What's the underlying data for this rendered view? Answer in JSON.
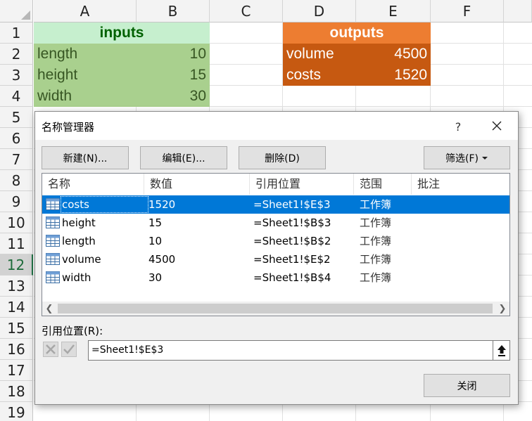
{
  "sheet": {
    "columns": [
      "A",
      "B",
      "C",
      "D",
      "E",
      "F"
    ],
    "rows": [
      "1",
      "2",
      "3",
      "4",
      "5",
      "6",
      "7",
      "8",
      "9",
      "10",
      "11",
      "12",
      "13",
      "14",
      "15",
      "16",
      "17",
      "18",
      "19"
    ],
    "selected_row": "12",
    "inputs_header": "inputs",
    "outputs_header": "outputs",
    "inputs": [
      {
        "label": "length",
        "value": "10"
      },
      {
        "label": "height",
        "value": "15"
      },
      {
        "label": "width",
        "value": "30"
      }
    ],
    "outputs": [
      {
        "label": "volume",
        "value": "4500"
      },
      {
        "label": "costs",
        "value": "1520"
      }
    ],
    "colors": {
      "inputs_header_bg": "#c6efce",
      "inputs_body_bg": "#a9d08e",
      "outputs_header_bg": "#ed7d31",
      "outputs_body_bg": "#c65911"
    }
  },
  "dialog": {
    "title": "名称管理器",
    "help": "?",
    "buttons": {
      "new": "新建(N)...",
      "edit": "编辑(E)...",
      "delete": "删除(D)",
      "filter": "筛选(F)",
      "close": "关闭"
    },
    "columns": [
      "名称",
      "数值",
      "引用位置",
      "范围",
      "批注"
    ],
    "names": [
      {
        "name": "costs",
        "value": "1520",
        "refers_to": "=Sheet1!$E$3",
        "scope": "工作簿",
        "comment": ""
      },
      {
        "name": "height",
        "value": "15",
        "refers_to": "=Sheet1!$B$3",
        "scope": "工作簿",
        "comment": ""
      },
      {
        "name": "length",
        "value": "10",
        "refers_to": "=Sheet1!$B$2",
        "scope": "工作簿",
        "comment": ""
      },
      {
        "name": "volume",
        "value": "4500",
        "refers_to": "=Sheet1!$E$2",
        "scope": "工作簿",
        "comment": ""
      },
      {
        "name": "width",
        "value": "30",
        "refers_to": "=Sheet1!$B$4",
        "scope": "工作簿",
        "comment": ""
      }
    ],
    "selected_index": 0,
    "refers_to_label": "引用位置(R):",
    "refers_to_value": "=Sheet1!$E$3",
    "icons": {
      "close": "close-icon",
      "cancel_edit": "cancel-x-icon",
      "confirm_edit": "checkmark-icon",
      "collapse": "collapse-dialog-icon",
      "name_row": "table-name-icon",
      "scroll_left": "chevron-left-icon",
      "scroll_right": "chevron-right-icon",
      "filter_dropdown": "triangle-down-icon"
    },
    "colors": {
      "selection": "#0078d7"
    }
  }
}
